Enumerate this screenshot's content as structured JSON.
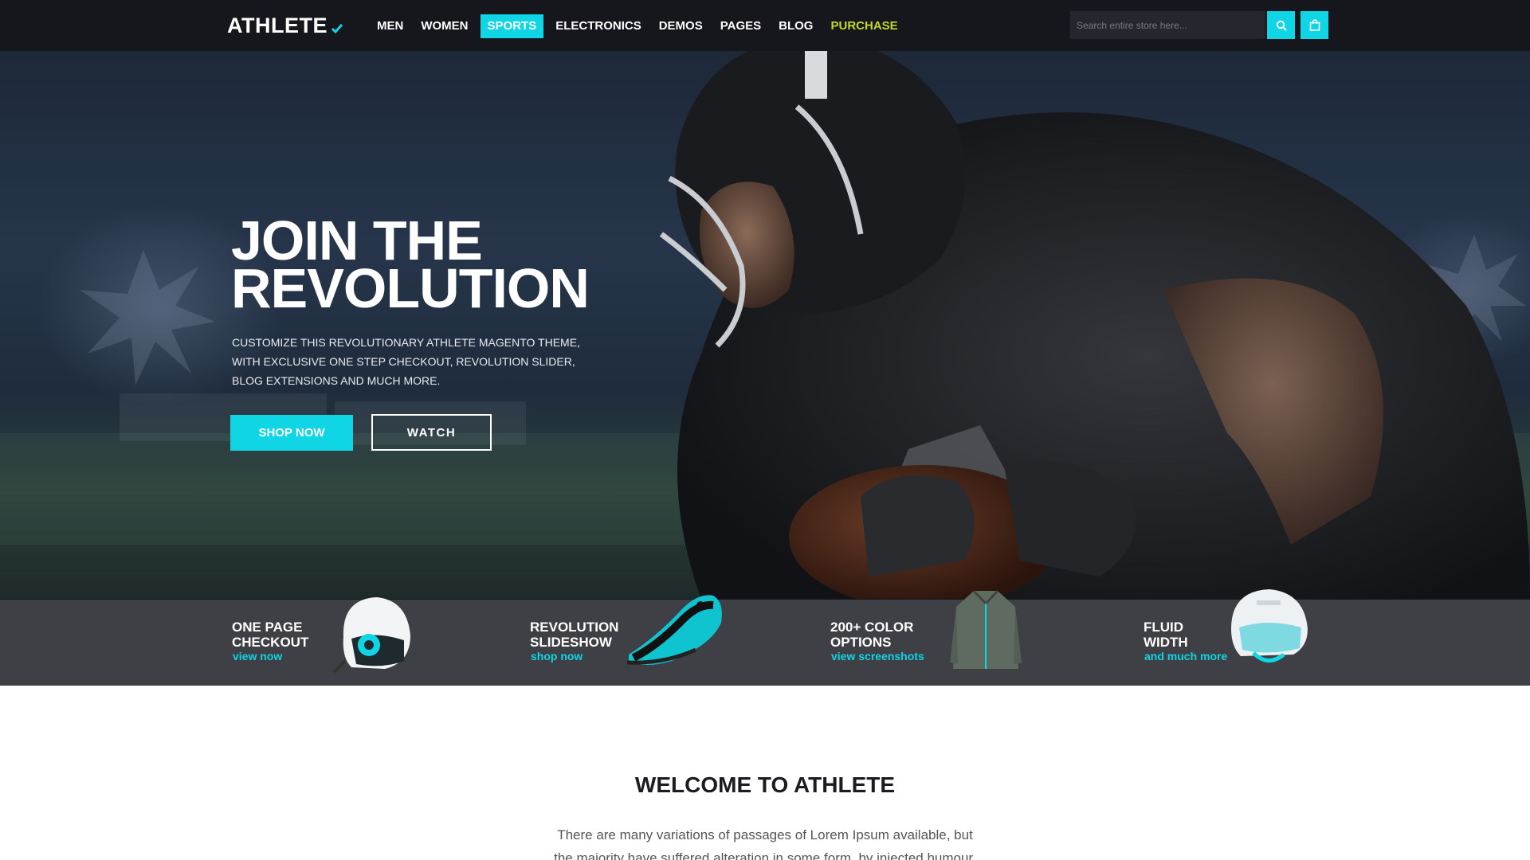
{
  "brand": {
    "logo_text": "ATHLETE",
    "accent_color": "#10d5e5",
    "purchase_color": "#c3d92a"
  },
  "nav": {
    "items": [
      {
        "label": "MEN"
      },
      {
        "label": "WOMEN"
      },
      {
        "label": "SPORTS",
        "active": true
      },
      {
        "label": "ELECTRONICS"
      },
      {
        "label": "DEMOS"
      },
      {
        "label": "PAGES"
      },
      {
        "label": "BLOG"
      },
      {
        "label": "PURCHASE",
        "highlight": true
      }
    ]
  },
  "search": {
    "placeholder": "Search entire store here...",
    "button_icon": "search-icon",
    "cart_icon": "shopping-bag-icon"
  },
  "hero": {
    "title_line1": "JOIN THE",
    "title_line2": "REVOLUTION",
    "desc_line1": "CUSTOMIZE THIS REVOLUTIONARY ATHLETE MAGENTO THEME,",
    "desc_line2": "WITH EXCLUSIVE ONE STEP CHECKOUT, REVOLUTION SLIDER,",
    "desc_line3": "BLOG EXTENSIONS AND MUCH MORE.",
    "shop_button": "SHOP NOW",
    "watch_button": "WATCH"
  },
  "features": [
    {
      "title_line1": "ONE PAGE",
      "title_line2": "CHECKOUT",
      "link": "view now",
      "image": "ski-helmet-icon"
    },
    {
      "title_line1": "REVOLUTION",
      "title_line2": "SLIDESHOW",
      "link": "shop now",
      "image": "running-shoe-icon"
    },
    {
      "title_line1": "200+ COLOR",
      "title_line2": "OPTIONS",
      "link": "view screenshots",
      "image": "jacket-icon"
    },
    {
      "title_line1": "FLUID",
      "title_line2": "WIDTH",
      "link": "and much more",
      "image": "helmet-icon"
    }
  ],
  "welcome": {
    "title": "WELCOME TO ATHLETE",
    "text_line1": "There are many variations of passages of Lorem Ipsum available, but",
    "text_line2": "the majority have suffered alteration in some form, by injected humour,"
  }
}
